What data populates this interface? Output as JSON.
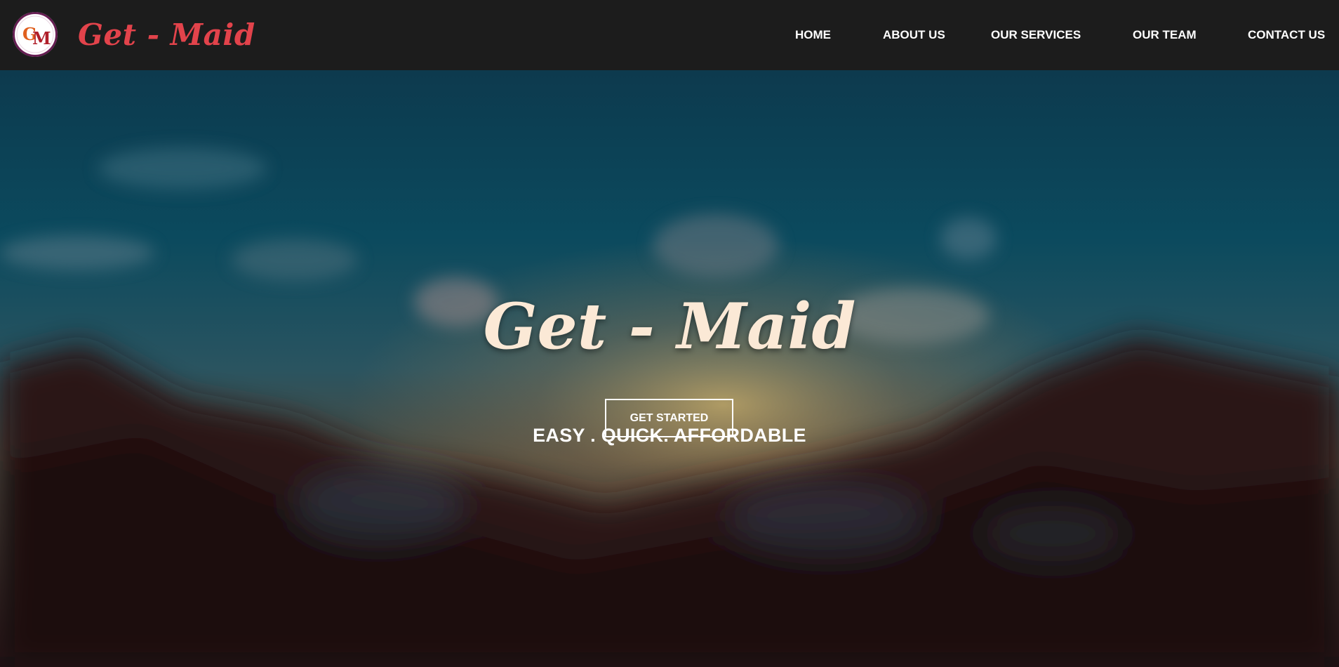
{
  "header": {
    "logo": {
      "icon": "gm-monogram-logo",
      "text": "GM"
    },
    "brand": "Get - Maid",
    "nav": [
      {
        "label": "HOME"
      },
      {
        "label": "ABOUT US"
      },
      {
        "label": "OUR SERVICES"
      },
      {
        "label": "OUR TEAM"
      },
      {
        "label": "CONTACT US"
      }
    ]
  },
  "hero": {
    "title": "Get - Maid",
    "tagline": "EASY . QUICK. AFFORDABLE",
    "cta_label": "GET STARTED"
  },
  "colors": {
    "navbar_bg": "#1c1c1c",
    "brand": "#e2434b",
    "hero_title": "#fbe9d6",
    "nav_text": "#ffffff"
  }
}
